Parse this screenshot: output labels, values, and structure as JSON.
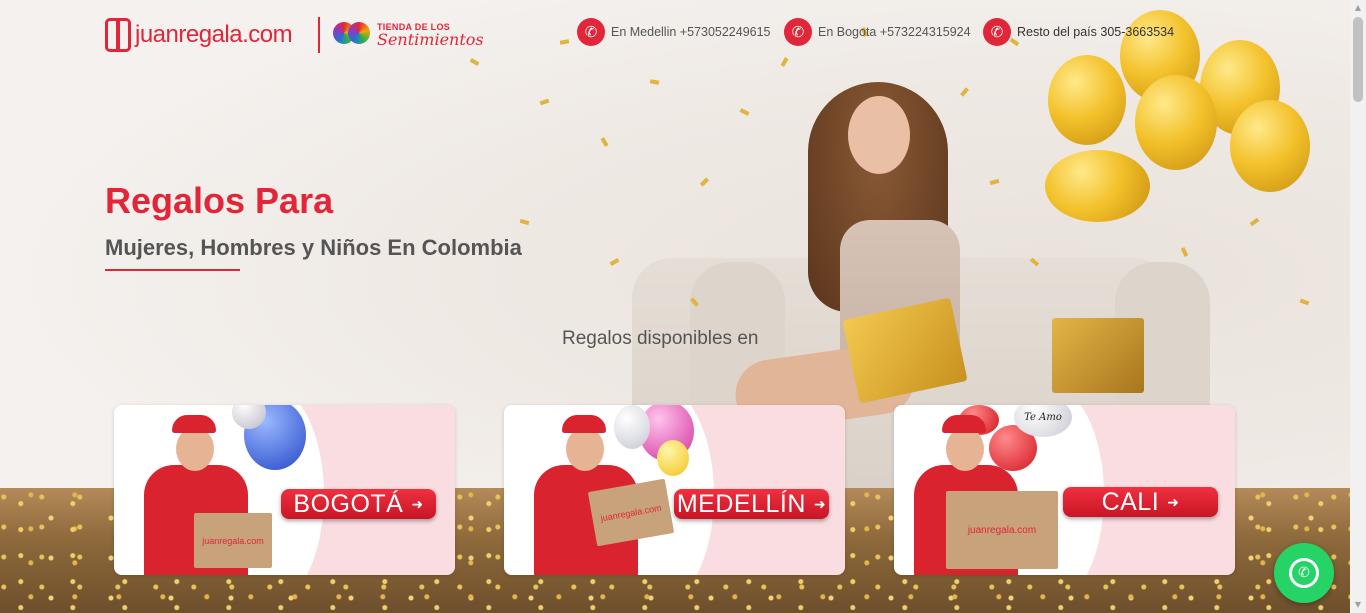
{
  "header": {
    "logo_text": "juanregala.com",
    "tienda_top": "TIENDA DE LOS",
    "tienda_bottom": "Sentimientos",
    "phones": [
      {
        "label": "En Medellin +573052249615"
      },
      {
        "label": "En Bogota +573224315924"
      },
      {
        "label": "Resto del país 305-3663534"
      }
    ]
  },
  "hero": {
    "title": "Regalos Para",
    "subtitle": "Mujeres, Hombres y Niños En Colombia",
    "available": "Regalos disponibles en"
  },
  "cities": [
    {
      "label": "BOGOTÁ",
      "box_text": "juanregala.com"
    },
    {
      "label": "MEDELLÍN",
      "box_text": "juanregala.com"
    },
    {
      "label": "CALI",
      "box_text": "juanregala.com"
    }
  ],
  "cali_balloon_text": "Te Amo",
  "icons": {
    "phone": "phone-icon",
    "whatsapp": "whatsapp-icon",
    "arrow": "arrow-right-icon"
  },
  "colors": {
    "brand_red": "#e1263a",
    "card_pink": "#f9dde0",
    "whatsapp_green": "#25d366"
  }
}
